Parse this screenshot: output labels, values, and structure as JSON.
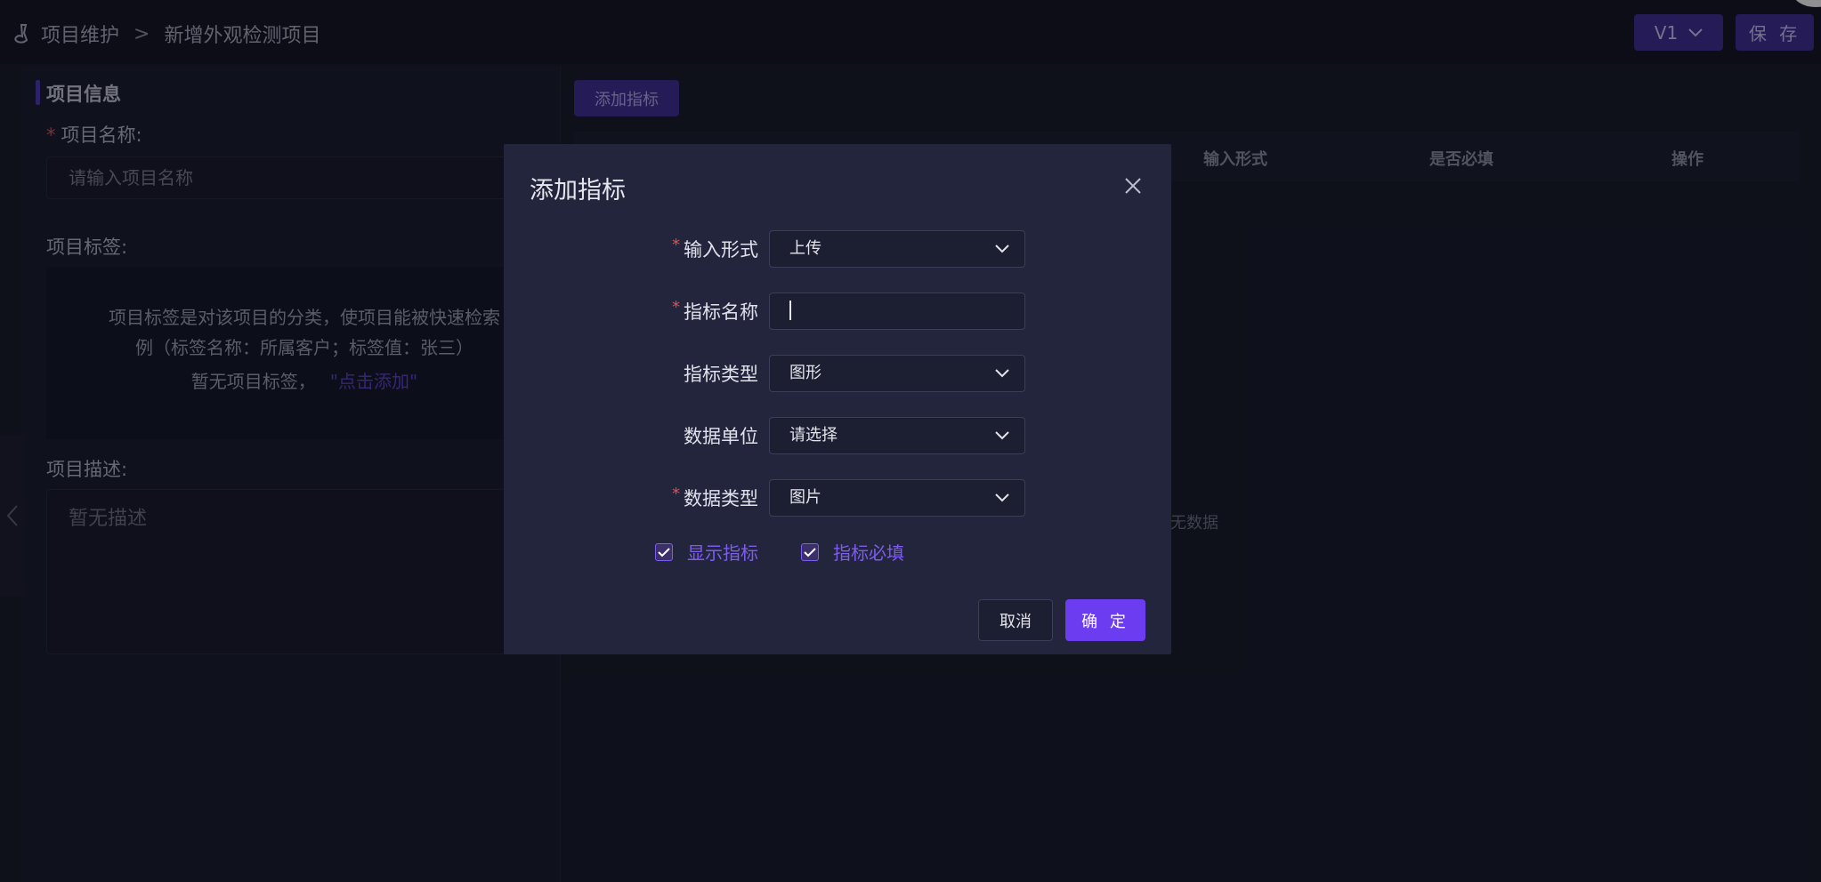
{
  "breadcrumb": {
    "root": "项目维护",
    "separator": ">",
    "current": "新增外观检测项目"
  },
  "header": {
    "version": "V1",
    "save": "保 存"
  },
  "left": {
    "section_title": "项目信息",
    "name_label": "项目名称:",
    "name_placeholder": "请输入项目名称",
    "tag_label": "项目标签:",
    "tag_hint_1": "项目标签是对该项目的分类，使项目能被快速检索",
    "tag_hint_2": "例（标签名称：所属客户；标签值：张三）",
    "tag_empty": "暂无项目标签，",
    "tag_add_link": "\"点击添加\"",
    "desc_label": "项目描述:",
    "desc_empty": "暂无描述"
  },
  "right": {
    "add_index": "添加指标",
    "columns": [
      "输入形式",
      "是否必填",
      "操作"
    ],
    "empty": "无数据"
  },
  "modal": {
    "title": "添加指标",
    "fields": [
      {
        "label": "输入形式",
        "value": "上传"
      },
      {
        "label": "指标名称",
        "value": ""
      },
      {
        "label": "指标类型",
        "value": "图形"
      },
      {
        "label": "数据单位",
        "value": "请选择"
      },
      {
        "label": "数据类型",
        "value": "图片"
      }
    ],
    "show_index": "显示指标",
    "required_index": "指标必填",
    "cancel": "取消",
    "ok": "确 定"
  },
  "colors": {
    "accent": "#6b3cf0",
    "button_dim": "#3d2a93",
    "required": "#e0504f"
  }
}
